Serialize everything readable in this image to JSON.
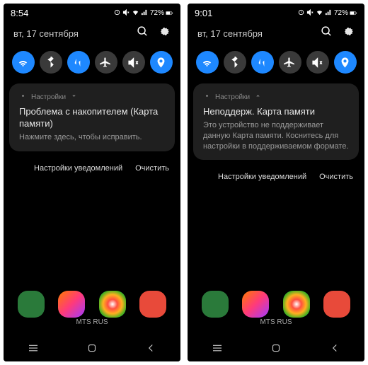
{
  "phones": [
    {
      "time": "8:54",
      "battery": "72%",
      "date": "вт, 17 сентября",
      "notif_app": "Настройки",
      "notif_title": "Проблема с накопителем (Карта памяти)",
      "notif_body": "Нажмите здесь, чтобы исправить.",
      "action1": "Настройки уведомлений",
      "action2": "Очистить",
      "carrier": "MTS RUS",
      "expanded": false
    },
    {
      "time": "9:01",
      "battery": "72%",
      "date": "вт, 17 сентября",
      "notif_app": "Настройки",
      "notif_title": "Неподдерж. Карта памяти",
      "notif_body": "Это устройство не поддерживает данную Карта памяти. Коснитесь для настройки в поддерживаемом формате.",
      "action1": "Настройки уведомлений",
      "action2": "Очистить",
      "carrier": "MTS RUS",
      "expanded": true
    }
  ],
  "qs_icons": [
    "wifi",
    "bluetooth",
    "data",
    "airplane",
    "mute",
    "location"
  ],
  "qs_states": [
    true,
    false,
    true,
    false,
    false,
    true
  ],
  "dock_apps": [
    {
      "bg": "#2a7a3a",
      "icon": "phone"
    },
    {
      "bg": "linear-gradient(135deg,#ff7a00,#ff3a7a,#a03aff)",
      "icon": "instagram"
    },
    {
      "bg": "radial-gradient(#fff,#ff5040,#ffb020,#40b020,#2060ff)",
      "icon": "chrome"
    },
    {
      "bg": "#e84a3a",
      "icon": "camera"
    }
  ]
}
